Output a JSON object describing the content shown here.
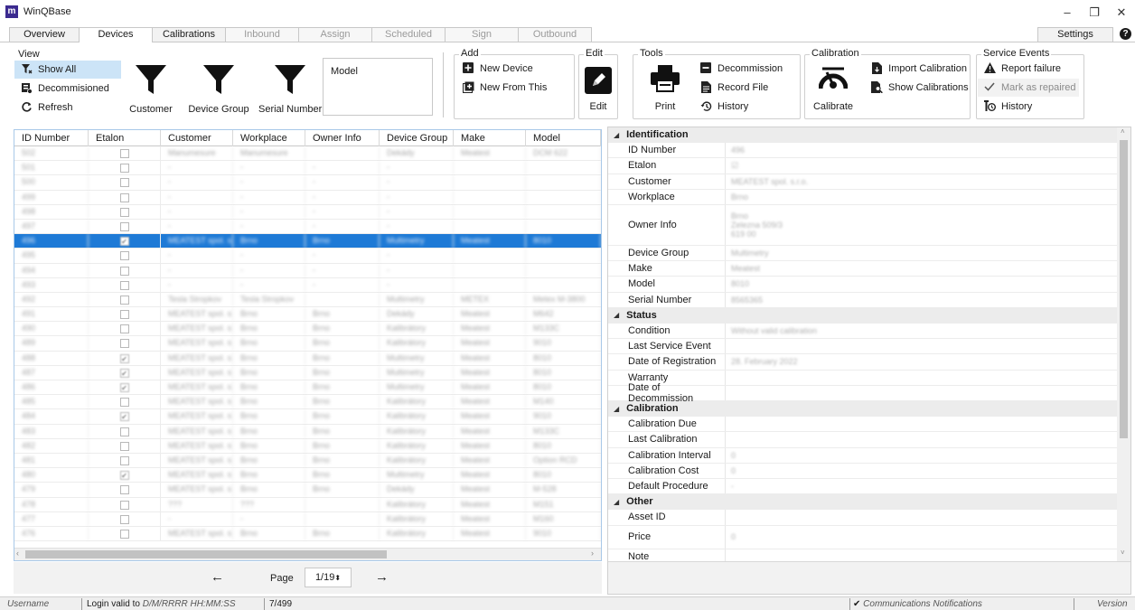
{
  "window": {
    "logo": "m",
    "title": "WinQBase",
    "minimize": "–",
    "maximize": "❐",
    "close": "✕"
  },
  "tabs": [
    {
      "label": "Overview",
      "state": "normal"
    },
    {
      "label": "Devices",
      "state": "active"
    },
    {
      "label": "Calibrations",
      "state": "normal"
    },
    {
      "label": "Inbound",
      "state": "disabled"
    },
    {
      "label": "Assign",
      "state": "disabled"
    },
    {
      "label": "Scheduled",
      "state": "disabled"
    },
    {
      "label": "Sign",
      "state": "disabled"
    },
    {
      "label": "Outbound",
      "state": "disabled"
    }
  ],
  "settings_label": "Settings",
  "help_label": "?",
  "ribbon": {
    "view": {
      "title": "View",
      "show_all": "Show All",
      "decommissioned": "Decommisioned",
      "refresh": "Refresh",
      "filter_customer": "Customer",
      "filter_device_group": "Device Group",
      "filter_serial_number": "Serial Number",
      "model_label": "Model"
    },
    "add": {
      "title": "Add",
      "new_device": "New Device",
      "new_from_this": "New From This"
    },
    "edit": {
      "title": "Edit",
      "edit_label": "Edit"
    },
    "tools": {
      "title": "Tools",
      "print": "Print",
      "decommission": "Decommission",
      "record_file": "Record File",
      "history": "History"
    },
    "calibration": {
      "title": "Calibration",
      "calibrate": "Calibrate",
      "import_calibration": "Import Calibration",
      "show_calibrations": "Show Calibrations"
    },
    "service": {
      "title": "Service Events",
      "report_failure": "Report failure",
      "mark_as_repaired": "Mark as repaired",
      "history": "History"
    }
  },
  "grid": {
    "columns": [
      "ID Number",
      "Etalon",
      "Customer",
      "Workplace",
      "Owner Info",
      "Device Group",
      "Make",
      "Model"
    ],
    "rows": [
      {
        "id": "502",
        "etalon": false,
        "customer": "Manumesure",
        "workplace": "Manumesure",
        "owner": "",
        "group": "Dekády",
        "make": "Meatest",
        "model": "DCM 622"
      },
      {
        "id": "501",
        "etalon": false,
        "customer": "-",
        "workplace": "-",
        "owner": "-",
        "group": "-",
        "make": "",
        "model": ""
      },
      {
        "id": "500",
        "etalon": false,
        "customer": "-",
        "workplace": "-",
        "owner": "-",
        "group": "-",
        "make": "",
        "model": ""
      },
      {
        "id": "499",
        "etalon": false,
        "customer": "-",
        "workplace": "-",
        "owner": "-",
        "group": "-",
        "make": "",
        "model": ""
      },
      {
        "id": "498",
        "etalon": false,
        "customer": "-",
        "workplace": "-",
        "owner": "-",
        "group": "-",
        "make": "",
        "model": ""
      },
      {
        "id": "497",
        "etalon": false,
        "customer": "-",
        "workplace": "-",
        "owner": "-",
        "group": "-",
        "make": "",
        "model": ""
      },
      {
        "id": "496",
        "etalon": true,
        "customer": "MEATEST spol. s.r.",
        "workplace": "Brno",
        "owner": "Brno",
        "group": "Multimetry",
        "make": "Meatest",
        "model": "8010",
        "selected": true
      },
      {
        "id": "495",
        "etalon": false,
        "customer": "-",
        "workplace": "-",
        "owner": "-",
        "group": "-",
        "make": "",
        "model": ""
      },
      {
        "id": "494",
        "etalon": false,
        "customer": "-",
        "workplace": "-",
        "owner": "-",
        "group": "-",
        "make": "",
        "model": ""
      },
      {
        "id": "493",
        "etalon": false,
        "customer": "-",
        "workplace": "-",
        "owner": "-",
        "group": "-",
        "make": "",
        "model": ""
      },
      {
        "id": "492",
        "etalon": false,
        "customer": "Tesla Stropkov",
        "workplace": "Tesla Stropkov",
        "owner": "",
        "group": "Multimetry",
        "make": "METEX",
        "model": "Metex M-3800"
      },
      {
        "id": "491",
        "etalon": false,
        "customer": "MEATEST spol. s.r.",
        "workplace": "Brno",
        "owner": "Brno",
        "group": "Dekády",
        "make": "Meatest",
        "model": "M642"
      },
      {
        "id": "490",
        "etalon": false,
        "customer": "MEATEST spol. s.r.",
        "workplace": "Brno",
        "owner": "Brno",
        "group": "Kalibrátory",
        "make": "Meatest",
        "model": "M133C"
      },
      {
        "id": "489",
        "etalon": false,
        "customer": "MEATEST spol. s.r.",
        "workplace": "Brno",
        "owner": "Brno",
        "group": "Kalibrátory",
        "make": "Meatest",
        "model": "9010"
      },
      {
        "id": "488",
        "etalon": true,
        "customer": "MEATEST spol. s.r.",
        "workplace": "Brno",
        "owner": "Brno",
        "group": "Multimetry",
        "make": "Meatest",
        "model": "8010"
      },
      {
        "id": "487",
        "etalon": true,
        "customer": "MEATEST spol. s.r.",
        "workplace": "Brno",
        "owner": "Brno",
        "group": "Multimetry",
        "make": "Meatest",
        "model": "8010"
      },
      {
        "id": "486",
        "etalon": true,
        "customer": "MEATEST spol. s.r.",
        "workplace": "Brno",
        "owner": "Brno",
        "group": "Multimetry",
        "make": "Meatest",
        "model": "8010"
      },
      {
        "id": "485",
        "etalon": false,
        "customer": "MEATEST spol. s.r.",
        "workplace": "Brno",
        "owner": "Brno",
        "group": "Kalibrátory",
        "make": "Meatest",
        "model": "M140"
      },
      {
        "id": "484",
        "etalon": true,
        "customer": "MEATEST spol. s.r.",
        "workplace": "Brno",
        "owner": "Brno",
        "group": "Kalibrátory",
        "make": "Meatest",
        "model": "9010"
      },
      {
        "id": "483",
        "etalon": false,
        "customer": "MEATEST spol. s.r.",
        "workplace": "Brno",
        "owner": "Brno",
        "group": "Kalibrátory",
        "make": "Meatest",
        "model": "M133C"
      },
      {
        "id": "482",
        "etalon": false,
        "customer": "MEATEST spol. s.r.",
        "workplace": "Brno",
        "owner": "Brno",
        "group": "Kalibrátory",
        "make": "Meatest",
        "model": "8010"
      },
      {
        "id": "481",
        "etalon": false,
        "customer": "MEATEST spol. s.r.",
        "workplace": "Brno",
        "owner": "Brno",
        "group": "Kalibrátory",
        "make": "Meatest",
        "model": "Option RCD"
      },
      {
        "id": "480",
        "etalon": true,
        "customer": "MEATEST spol. s.r.",
        "workplace": "Brno",
        "owner": "Brno",
        "group": "Multimetry",
        "make": "Meatest",
        "model": "8010"
      },
      {
        "id": "479",
        "etalon": false,
        "customer": "MEATEST spol. s.r.",
        "workplace": "Brno",
        "owner": "Brno",
        "group": "Dekády",
        "make": "Meatest",
        "model": "M-528"
      },
      {
        "id": "478",
        "etalon": false,
        "customer": "???",
        "workplace": "???",
        "owner": "",
        "group": "Kalibrátory",
        "make": "Meatest",
        "model": "M151"
      },
      {
        "id": "477",
        "etalon": false,
        "customer": "-",
        "workplace": "-",
        "owner": "",
        "group": "Kalibrátory",
        "make": "Meatest",
        "model": "M160"
      },
      {
        "id": "476",
        "etalon": false,
        "customer": "MEATEST spol. s.r.",
        "workplace": "Brno",
        "owner": "Brno",
        "group": "Kalibrátory",
        "make": "Meatest",
        "model": "9010"
      }
    ]
  },
  "pager": {
    "prev": "←",
    "label": "Page",
    "value": "1/19",
    "next": "→"
  },
  "properties": [
    {
      "category": "Identification"
    },
    {
      "key": "ID Number",
      "value": "496"
    },
    {
      "key": "Etalon",
      "value": "☑"
    },
    {
      "key": "Customer",
      "value": "MEATEST spol. s.r.o."
    },
    {
      "key": "Workplace",
      "value": "Brno"
    },
    {
      "key": "Owner Info",
      "value": "Brno\nZelezna 509/3\n619 00",
      "tall": true
    },
    {
      "key": "Device Group",
      "value": "Multimetry"
    },
    {
      "key": "Make",
      "value": "Meatest"
    },
    {
      "key": "Model",
      "value": "8010"
    },
    {
      "key": "Serial Number",
      "value": "8565365"
    },
    {
      "category": "Status"
    },
    {
      "key": "Condition",
      "value": "Without valid calibration"
    },
    {
      "key": "Last Service Event",
      "value": ""
    },
    {
      "key": "Date of Registration",
      "value": "28. February 2022"
    },
    {
      "key": "Warranty",
      "value": ""
    },
    {
      "key": "Date of Decommission",
      "value": ""
    },
    {
      "category": "Calibration"
    },
    {
      "key": "Calibration Due",
      "value": ""
    },
    {
      "key": "Last Calibration",
      "value": ""
    },
    {
      "key": "Calibration Interval",
      "value": "0"
    },
    {
      "key": "Calibration Cost",
      "value": "0"
    },
    {
      "key": "Default Procedure",
      "value": "-"
    },
    {
      "category": "Other"
    },
    {
      "key": "Asset ID",
      "value": ""
    },
    {
      "key": "Price",
      "value": "0",
      "tall2": true
    },
    {
      "key": "Note",
      "value": ""
    }
  ],
  "status_bar": {
    "username": "Username",
    "login_label": "Login valid to",
    "login_value": "D/M/RRRR  HH:MM:SS",
    "count": "7/499",
    "notifications": "Communications Notifications",
    "version": "Version"
  }
}
